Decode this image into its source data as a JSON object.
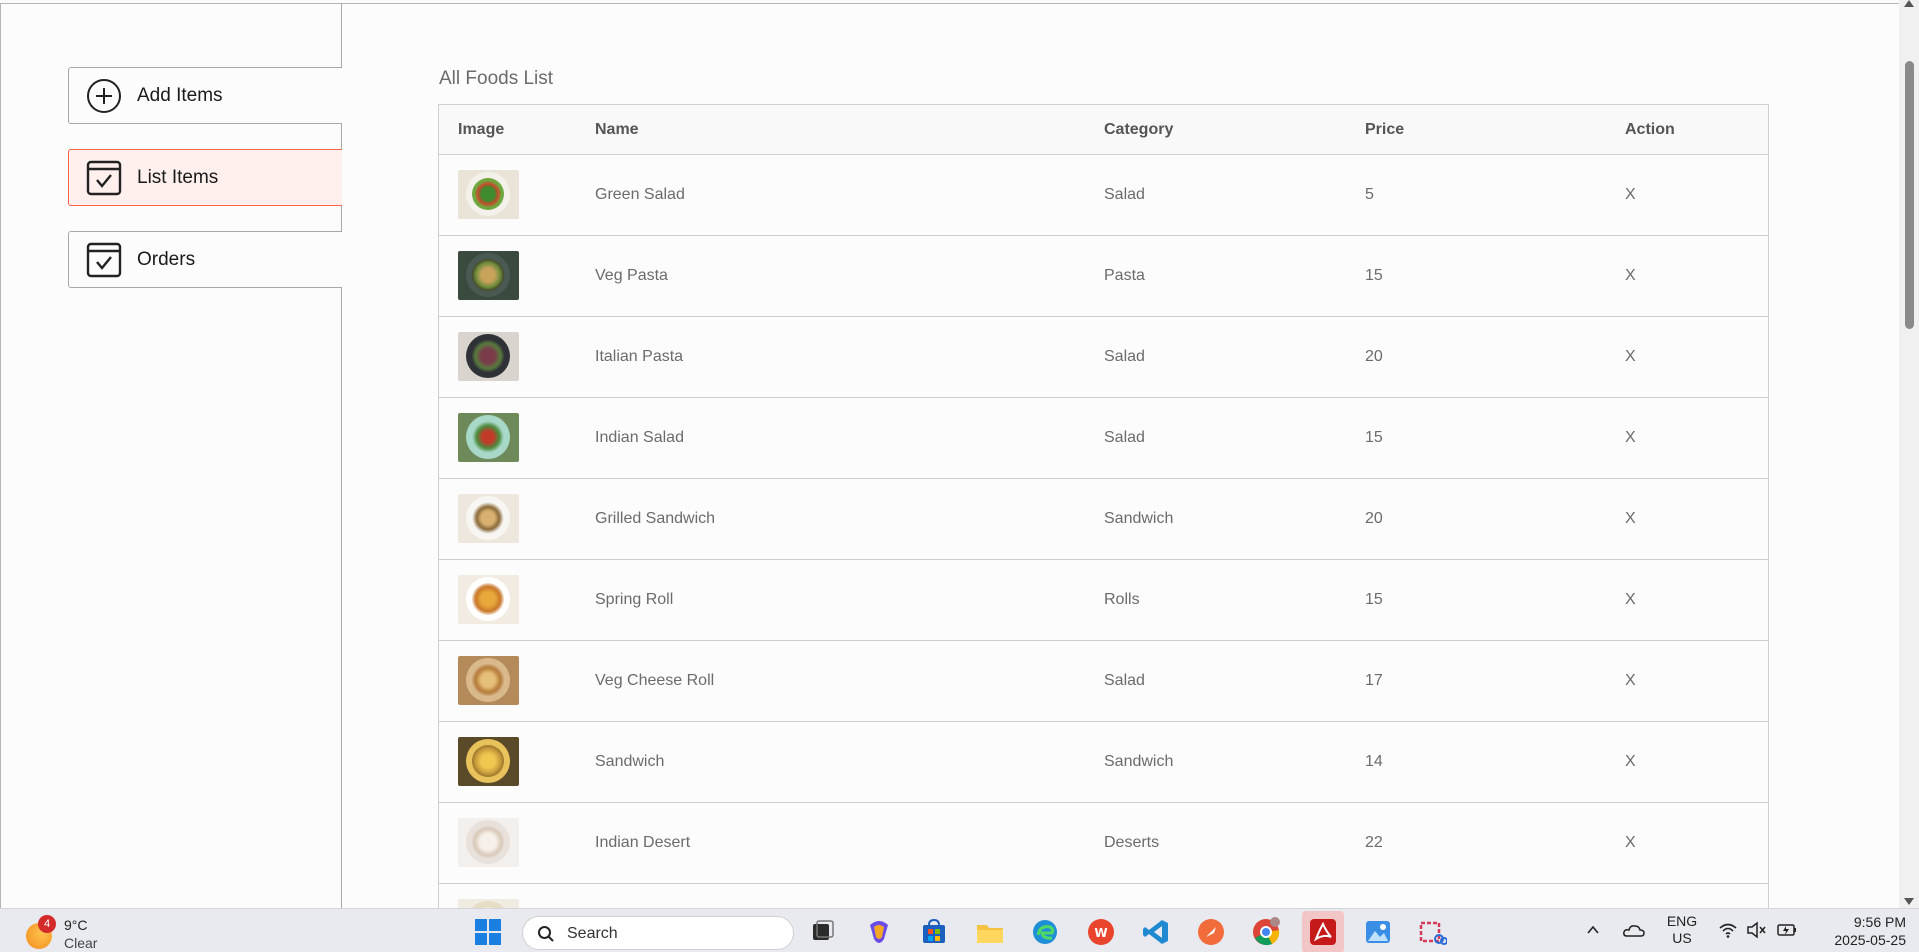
{
  "sidebar": {
    "items": [
      {
        "label": "Add Items",
        "icon": "add-circle-icon"
      },
      {
        "label": "List Items",
        "icon": "checkbox-icon"
      },
      {
        "label": "Orders",
        "icon": "checkbox-icon"
      }
    ],
    "active_index": 1,
    "accent_color": "#ff6347"
  },
  "page": {
    "title": "All Foods List"
  },
  "table": {
    "headers": {
      "image": "Image",
      "name": "Name",
      "category": "Category",
      "price": "Price",
      "action": "Action"
    },
    "rows": [
      {
        "name": "Green Salad",
        "category": "Salad",
        "price": "5",
        "action": "X",
        "photo": "salad"
      },
      {
        "name": "Veg Pasta",
        "category": "Pasta",
        "price": "15",
        "action": "X",
        "photo": "pasta"
      },
      {
        "name": "Italian Pasta",
        "category": "Salad",
        "price": "20",
        "action": "X",
        "photo": "pasta-dark"
      },
      {
        "name": "Indian Salad",
        "category": "Salad",
        "price": "15",
        "action": "X",
        "photo": "salad-red"
      },
      {
        "name": "Grilled Sandwich",
        "category": "Sandwich",
        "price": "20",
        "action": "X",
        "photo": "sandwich"
      },
      {
        "name": "Spring Roll",
        "category": "Rolls",
        "price": "15",
        "action": "X",
        "photo": "roll"
      },
      {
        "name": "Veg Cheese Roll",
        "category": "Salad",
        "price": "17",
        "action": "X",
        "photo": "roll-board"
      },
      {
        "name": "Sandwich",
        "category": "Sandwich",
        "price": "14",
        "action": "X",
        "photo": "sandwich-gold"
      },
      {
        "name": "Indian Desert",
        "category": "Deserts",
        "price": "22",
        "action": "X",
        "photo": "dessert"
      },
      {
        "name": "",
        "category": "",
        "price": "",
        "action": "",
        "photo": "partial"
      }
    ]
  },
  "taskbar": {
    "weather": {
      "badge": "4",
      "temp": "9°C",
      "condition": "Clear"
    },
    "search_placeholder": "Search",
    "language": {
      "line1": "ENG",
      "line2": "US"
    },
    "time": "9:56 PM",
    "date": "2025-05-25"
  }
}
